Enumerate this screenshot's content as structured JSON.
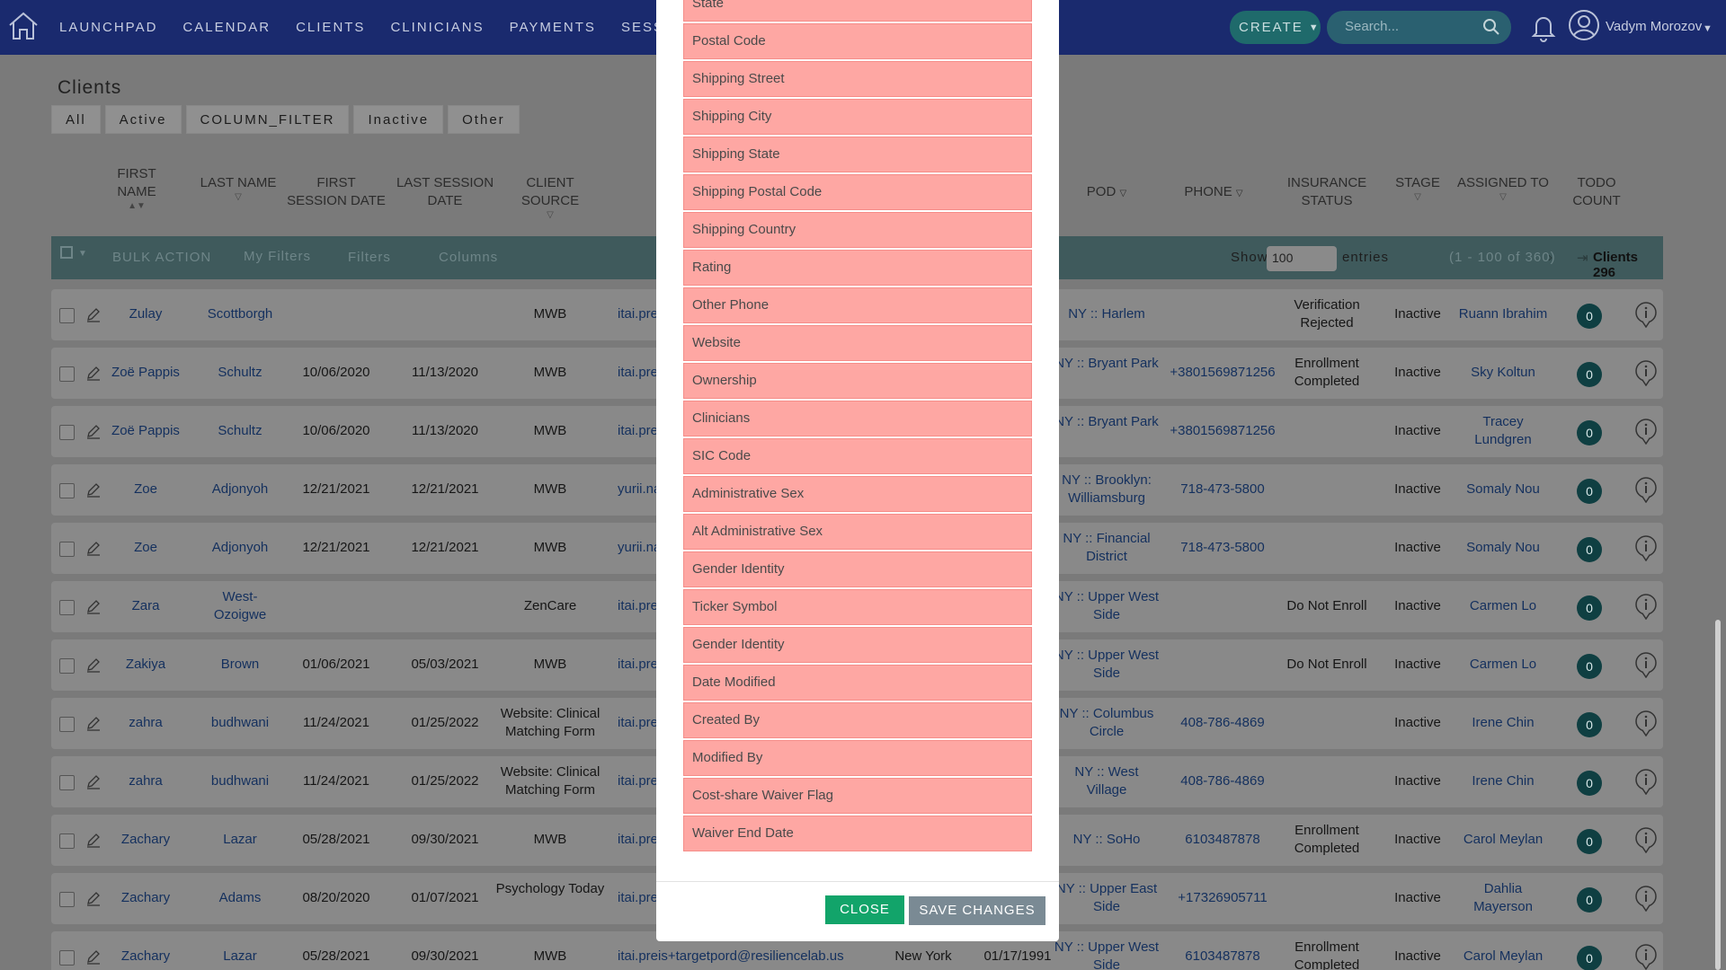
{
  "nav": {
    "links": [
      "LAUNCHPAD",
      "CALENDAR",
      "CLIENTS",
      "CLINICIANS",
      "PAYMENTS",
      "SESSIONS"
    ],
    "create_label": "CREATE",
    "search_placeholder": "Search...",
    "username": "Vadym Morozov"
  },
  "page": {
    "title": "Clients",
    "filter_tabs": [
      "All",
      "Active",
      "COLUMN_FILTER",
      "Inactive",
      "Other"
    ]
  },
  "table": {
    "headers": {
      "first_name": "FIRST NAME",
      "last_name": "LAST NAME",
      "first_session": "FIRST SESSION DATE",
      "last_session": "LAST SESSION DATE",
      "client_source": "CLIENT SOURCE",
      "pod": "POD",
      "phone": "PHONE",
      "insurance_status": "INSURANCE STATUS",
      "stage": "STAGE",
      "assigned_to": "ASSIGNED TO",
      "todo_count": "TODO COUNT"
    },
    "toolbar": {
      "bulk_action": "BULK ACTION",
      "my_filters": "My Filters",
      "filters": "Filters",
      "columns": "Columns",
      "show": "Show",
      "entries_value": "100",
      "entries": "entries",
      "range": "(1 - 100 of 360)",
      "clients_count": "Clients 296"
    },
    "rows": [
      {
        "first": "Zulay",
        "last": "Scottborgh",
        "fs": "",
        "ls": "",
        "source": "MWB",
        "email": "itai.pre",
        "state": "",
        "dob": "",
        "pod": "NY :: Harlem",
        "phone": "",
        "ins": "Verification Rejected",
        "stage": "Inactive",
        "assigned": "Ruann Ibrahim",
        "todo": "0"
      },
      {
        "first": "Zoë Pappis",
        "last": "Schultz",
        "fs": "10/06/2020",
        "ls": "11/13/2020",
        "source": "MWB",
        "email": "itai.pre",
        "state": "",
        "dob": "",
        "pod": "NY :: Bryant Park",
        "phone": "+3801569871256",
        "ins": "Enrollment Completed",
        "stage": "Inactive",
        "assigned": "Sky Koltun",
        "todo": "0"
      },
      {
        "first": "Zoë Pappis",
        "last": "Schultz",
        "fs": "10/06/2020",
        "ls": "11/13/2020",
        "source": "MWB",
        "email": "itai.pre",
        "state": "",
        "dob": "",
        "pod": "NY :: Bryant Park",
        "phone": "+3801569871256",
        "ins": "",
        "stage": "Inactive",
        "assigned": "Tracey Lundgren",
        "todo": "0"
      },
      {
        "first": "Zoe",
        "last": "Adjonyoh",
        "fs": "12/21/2021",
        "ls": "12/21/2021",
        "source": "MWB",
        "email": "yurii.na",
        "state": "",
        "dob": "",
        "pod": "NY :: Brooklyn: Williamsburg",
        "phone": "718-473-5800",
        "ins": "",
        "stage": "Inactive",
        "assigned": "Somaly Nou",
        "todo": "0"
      },
      {
        "first": "Zoe",
        "last": "Adjonyoh",
        "fs": "12/21/2021",
        "ls": "12/21/2021",
        "source": "MWB",
        "email": "yurii.na",
        "state": "",
        "dob": "",
        "pod": "NY :: Financial District",
        "phone": "718-473-5800",
        "ins": "",
        "stage": "Inactive",
        "assigned": "Somaly Nou",
        "todo": "0"
      },
      {
        "first": "Zara",
        "last": "West-Ozoigwe",
        "fs": "",
        "ls": "",
        "source": "ZenCare",
        "email": "itai.pre",
        "state": "",
        "dob": "",
        "pod": "NY :: Upper West Side",
        "phone": "",
        "ins": "Do Not Enroll",
        "stage": "Inactive",
        "assigned": "Carmen Lo",
        "todo": "0"
      },
      {
        "first": "Zakiya",
        "last": "Brown",
        "fs": "01/06/2021",
        "ls": "05/03/2021",
        "source": "MWB",
        "email": "itai.pre",
        "state": "",
        "dob": "",
        "pod": "NY :: Upper West Side",
        "phone": "",
        "ins": "Do Not Enroll",
        "stage": "Inactive",
        "assigned": "Carmen Lo",
        "todo": "0"
      },
      {
        "first": "zahra",
        "last": "budhwani",
        "fs": "11/24/2021",
        "ls": "01/25/2022",
        "source": "Website: Clinical Matching Form",
        "email": "itai.pre",
        "state": "",
        "dob": "",
        "pod": "NY :: Columbus Circle",
        "phone": "408-786-4869",
        "ins": "",
        "stage": "Inactive",
        "assigned": "Irene Chin",
        "todo": "0"
      },
      {
        "first": "zahra",
        "last": "budhwani",
        "fs": "11/24/2021",
        "ls": "01/25/2022",
        "source": "Website: Clinical Matching Form",
        "email": "itai.pre",
        "state": "",
        "dob": "",
        "pod": "NY :: West Village",
        "phone": "408-786-4869",
        "ins": "",
        "stage": "Inactive",
        "assigned": "Irene Chin",
        "todo": "0"
      },
      {
        "first": "Zachary",
        "last": "Lazar",
        "fs": "05/28/2021",
        "ls": "09/30/2021",
        "source": "MWB",
        "email": "itai.pre",
        "state": "",
        "dob": "",
        "pod": "NY :: SoHo",
        "phone": "6103487878",
        "ins": "Enrollment Completed",
        "stage": "Inactive",
        "assigned": "Carol Meylan",
        "todo": "0"
      },
      {
        "first": "Zachary",
        "last": "Adams",
        "fs": "08/20/2020",
        "ls": "01/07/2021",
        "source": "Psychology Today",
        "email": "itai.pre",
        "state": "",
        "dob": "",
        "pod": "NY :: Upper East Side",
        "phone": "+17326905711",
        "ins": "",
        "stage": "Inactive",
        "assigned": "Dahlia Mayerson",
        "todo": "0"
      },
      {
        "first": "Zachary",
        "last": "Lazar",
        "fs": "05/28/2021",
        "ls": "09/30/2021",
        "source": "MWB",
        "email": "itai.preis+targetpord@resiliencelab.us",
        "state": "New York",
        "dob": "01/17/1991",
        "pod": "NY :: Upper West Side",
        "phone": "6103487878",
        "ins": "Enrollment Completed",
        "stage": "Inactive",
        "assigned": "Carol Meylan",
        "todo": "0"
      }
    ]
  },
  "modal": {
    "columns": [
      "State",
      "Postal Code",
      "Shipping Street",
      "Shipping City",
      "Shipping State",
      "Shipping Postal Code",
      "Shipping Country",
      "Rating",
      "Other Phone",
      "Website",
      "Ownership",
      "Clinicians",
      "SIC Code",
      "Administrative Sex",
      "Alt Administrative Sex",
      "Gender Identity",
      "Ticker Symbol",
      "Gender Identity",
      "Date Modified",
      "Created By",
      "Modified By",
      "Cost-share Waiver Flag",
      "Waiver End Date"
    ],
    "close_label": "CLOSE",
    "save_label": "SAVE CHANGES"
  },
  "colors": {
    "nav_bg": "#1a2a6e",
    "column_item_bg": "#fea7a3",
    "close_button": "#12a46a",
    "save_button": "#7a8a94",
    "todo_badge": "#0f3f42"
  }
}
